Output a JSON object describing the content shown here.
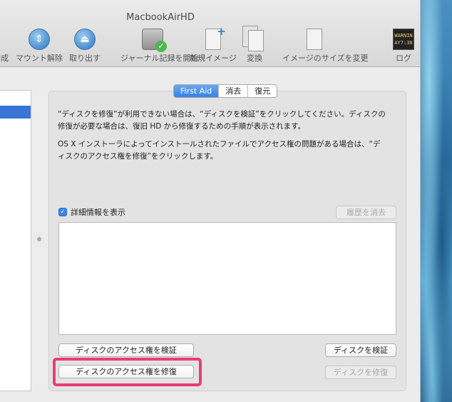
{
  "window": {
    "title": "MacbookAirHD"
  },
  "toolbar": {
    "items": [
      {
        "label": "作成"
      },
      {
        "label": "マウント解除"
      },
      {
        "label": "取り出す"
      },
      {
        "label": "ジャーナル記録を開始"
      },
      {
        "label": "新規イメージ"
      },
      {
        "label": "変換"
      },
      {
        "label": "イメージのサイズを変更"
      },
      {
        "label": "ログ",
        "icon_text_1": "WARNIN",
        "icon_text_2": "AY7:36"
      }
    ]
  },
  "tabs": [
    {
      "label": "First Aid",
      "active": true
    },
    {
      "label": "消去",
      "active": false
    },
    {
      "label": "復元",
      "active": false
    }
  ],
  "description": {
    "paragraph1_line1": "“ディスクを修復”が利用できない場合は、“ディスクを検証”をクリックしてください。ディスクの",
    "paragraph1_line2": "修復が必要な場合は、復旧 HD から修復するための手順が表示されます。",
    "paragraph2_line1": "OS X インストーラによってインストールされたファイルでアクセス権の問題がある場合は、“デ",
    "paragraph2_line2": "ィスクのアクセス権を修復”をクリックします。"
  },
  "details": {
    "checkbox_label": "詳細情報を表示",
    "checked": true,
    "clear_history_label": "履歴を消去"
  },
  "buttons": {
    "verify_permissions": "ディスクのアクセス権を検証",
    "verify_disk": "ディスクを検証",
    "repair_permissions": "ディスクのアクセス権を修復",
    "repair_disk": "ディスクを修復"
  },
  "colors": {
    "accent": "#3a80e6",
    "highlight": "#ee3a7a"
  }
}
